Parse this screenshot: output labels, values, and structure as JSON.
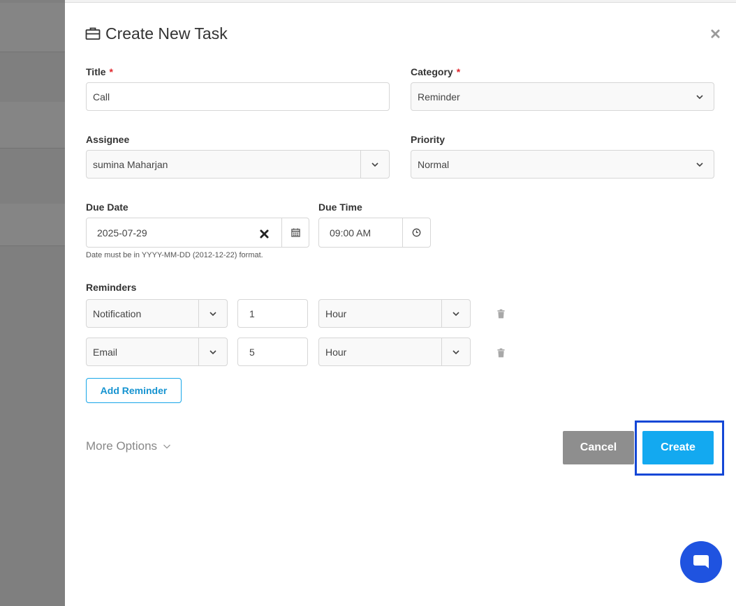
{
  "modal": {
    "title": "Create New Task",
    "title_icon": "briefcase-icon",
    "close_icon": "close-icon"
  },
  "fields": {
    "title": {
      "label": "Title",
      "required_mark": "*",
      "value": "Call"
    },
    "category": {
      "label": "Category",
      "required_mark": "*",
      "value": "Reminder"
    },
    "assignee": {
      "label": "Assignee",
      "value": "sumina Maharjan"
    },
    "priority": {
      "label": "Priority",
      "value": "Normal"
    },
    "due_date": {
      "label": "Due Date",
      "value": "2025-07-29",
      "help": "Date must be in YYYY-MM-DD (2012-12-22) format."
    },
    "due_time": {
      "label": "Due Time",
      "value": "09:00 AM"
    }
  },
  "reminders": {
    "label": "Reminders",
    "rows": [
      {
        "type": "Notification",
        "amount": "1",
        "unit": "Hour"
      },
      {
        "type": "Email",
        "amount": "5",
        "unit": "Hour"
      }
    ],
    "add_label": "Add Reminder"
  },
  "footer": {
    "more_options": "More Options",
    "cancel_label": "Cancel",
    "create_label": "Create"
  },
  "colors": {
    "primary": "#13a9f0",
    "highlight": "#1447d6",
    "required": "#e0262c",
    "chat": "#1f53e0"
  }
}
